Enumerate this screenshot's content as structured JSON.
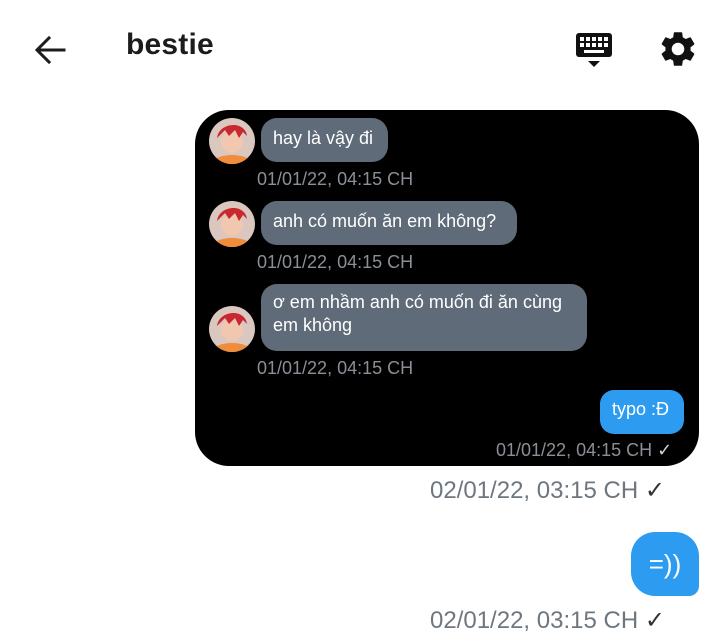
{
  "header": {
    "title": "bestie",
    "back_icon": "arrow-left-icon",
    "keyboard_icon": "keyboard-icon",
    "settings_icon": "gear-icon"
  },
  "quoted_card": {
    "messages": [
      {
        "text": "hay là vậy đi",
        "timestamp": "01/01/22, 04:15 CH"
      },
      {
        "text": "anh có muốn ăn em không?",
        "timestamp": "01/01/22, 04:15 CH"
      },
      {
        "line1": "ơ em nhầm anh có muốn đi ăn cùng",
        "line2": "em không",
        "timestamp": "01/01/22, 04:15 CH"
      }
    ],
    "reply": {
      "text": "typo :Đ",
      "timestamp": "01/01/22, 04:15 CH",
      "check": "✓"
    }
  },
  "sent": [
    {
      "timestamp": "02/01/22, 03:15 CH",
      "check": "✓"
    },
    {
      "text": "=))",
      "timestamp": "02/01/22, 03:15 CH",
      "check": "✓"
    }
  ],
  "colors": {
    "incoming_bubble": "#5f6b78",
    "outgoing_bubble": "#2d9cf0",
    "card_background": "#000000"
  }
}
